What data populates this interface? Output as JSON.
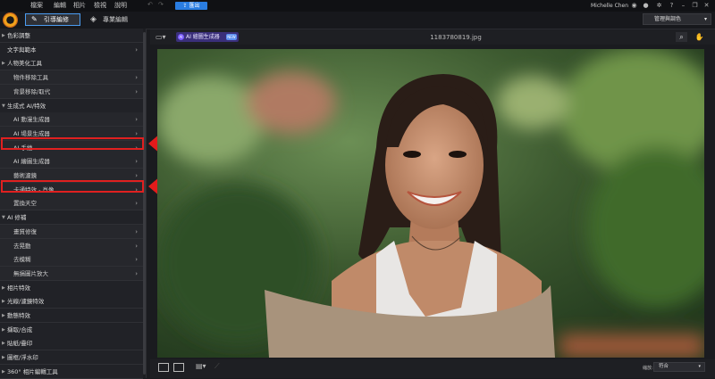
{
  "menubar": {
    "items": [
      "檔案",
      "編輯",
      "相片",
      "檢視",
      "說明"
    ],
    "undo": "↶",
    "redo": "↷",
    "export_label": "匯出",
    "user_name": "Michelle Chen",
    "window_icons": [
      "user-icon",
      "bell-icon",
      "gear-icon",
      "help-icon",
      "minimize-icon",
      "restore-icon",
      "close-icon"
    ]
  },
  "modebar": {
    "guided_tab": "引導編修",
    "pro_tab": "專業編輯",
    "display_dropdown": "管理與調色"
  },
  "left_panel": {
    "items": [
      {
        "label": "色彩調整",
        "type": "cat",
        "expand": "▶",
        "chev": ""
      },
      {
        "label": "文字與範本",
        "type": "cat",
        "expand": "",
        "chev": "›"
      },
      {
        "label": "人物美化工具",
        "type": "cat",
        "expand": "▶",
        "chev": ""
      },
      {
        "label": "物件移除工具",
        "type": "sub",
        "chev": "›"
      },
      {
        "label": "背景移除/取代",
        "type": "sub",
        "chev": "›"
      },
      {
        "label": "生成式 AI/特效",
        "type": "cat",
        "expand": "▼",
        "chev": ""
      },
      {
        "label": "AI 動漫生成器",
        "type": "sub",
        "chev": "›"
      },
      {
        "label": "AI 場景生成器",
        "type": "sub",
        "chev": "›"
      },
      {
        "label": "AI 手繪",
        "type": "sub",
        "chev": "›"
      },
      {
        "label": "AI 繪圖生成器",
        "type": "sub",
        "chev": "›"
      },
      {
        "label": "藝術濾鏡",
        "type": "sub",
        "chev": "›"
      },
      {
        "label": "卡通特效 - 肖像",
        "type": "sub",
        "chev": "›"
      },
      {
        "label": "置換天空",
        "type": "sub",
        "chev": "›"
      },
      {
        "label": "AI 修補",
        "type": "cat",
        "expand": "▼",
        "chev": ""
      },
      {
        "label": "畫質修復",
        "type": "sub",
        "chev": "›"
      },
      {
        "label": "去晃動",
        "type": "sub",
        "chev": "›"
      },
      {
        "label": "去模糊",
        "type": "sub",
        "chev": "›"
      },
      {
        "label": "無損圖片放大",
        "type": "sub",
        "chev": "›"
      },
      {
        "label": "相片特效",
        "type": "cat",
        "expand": "▶",
        "chev": ""
      },
      {
        "label": "光線/濾鏡特效",
        "type": "cat",
        "expand": "▶",
        "chev": ""
      },
      {
        "label": "動態特效",
        "type": "cat",
        "expand": "▶",
        "chev": ""
      },
      {
        "label": "擷取/合成",
        "type": "cat",
        "expand": "▶",
        "chev": ""
      },
      {
        "label": "貼紙/疊印",
        "type": "cat",
        "expand": "▶",
        "chev": ""
      },
      {
        "label": "圖框/浮水印",
        "type": "cat",
        "expand": "▶",
        "chev": ""
      },
      {
        "label": "360° 相片編輯工具",
        "type": "cat",
        "expand": "▶",
        "chev": ""
      }
    ]
  },
  "main": {
    "ai_generator_label": "AI 繪圖生成器",
    "ai_generator_badge": "NEW",
    "filename": "1183780819.jpg",
    "zoom_label": "縮放:",
    "zoom_value": "符合"
  },
  "colors": {
    "accent": "#2a7de1",
    "highlight": "#e02020"
  }
}
